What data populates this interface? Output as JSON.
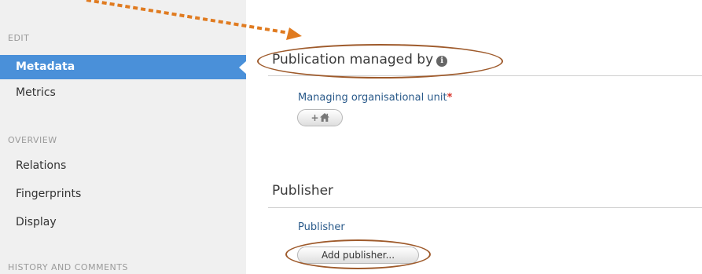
{
  "sidebar": {
    "sections": [
      {
        "header": "EDIT"
      },
      {
        "header": "OVERVIEW"
      },
      {
        "header": "HISTORY AND COMMENTS"
      }
    ],
    "items": [
      {
        "label": "Metadata",
        "active": true
      },
      {
        "label": "Metrics"
      },
      {
        "label": "Relations"
      },
      {
        "label": "Fingerprints"
      },
      {
        "label": "Display"
      }
    ]
  },
  "main": {
    "managed_section": {
      "title": "Publication managed by",
      "info_icon": "i",
      "field_label": "Managing organisational unit",
      "required_marker": "*",
      "add_button_icons": [
        "plus-icon",
        "home-icon"
      ]
    },
    "publisher_section": {
      "title": "Publisher",
      "field_label": "Publisher",
      "add_button_label": "Add publisher..."
    }
  },
  "annotation": {
    "color": "#9e5a2b",
    "arrow_color": "#e07b20"
  }
}
